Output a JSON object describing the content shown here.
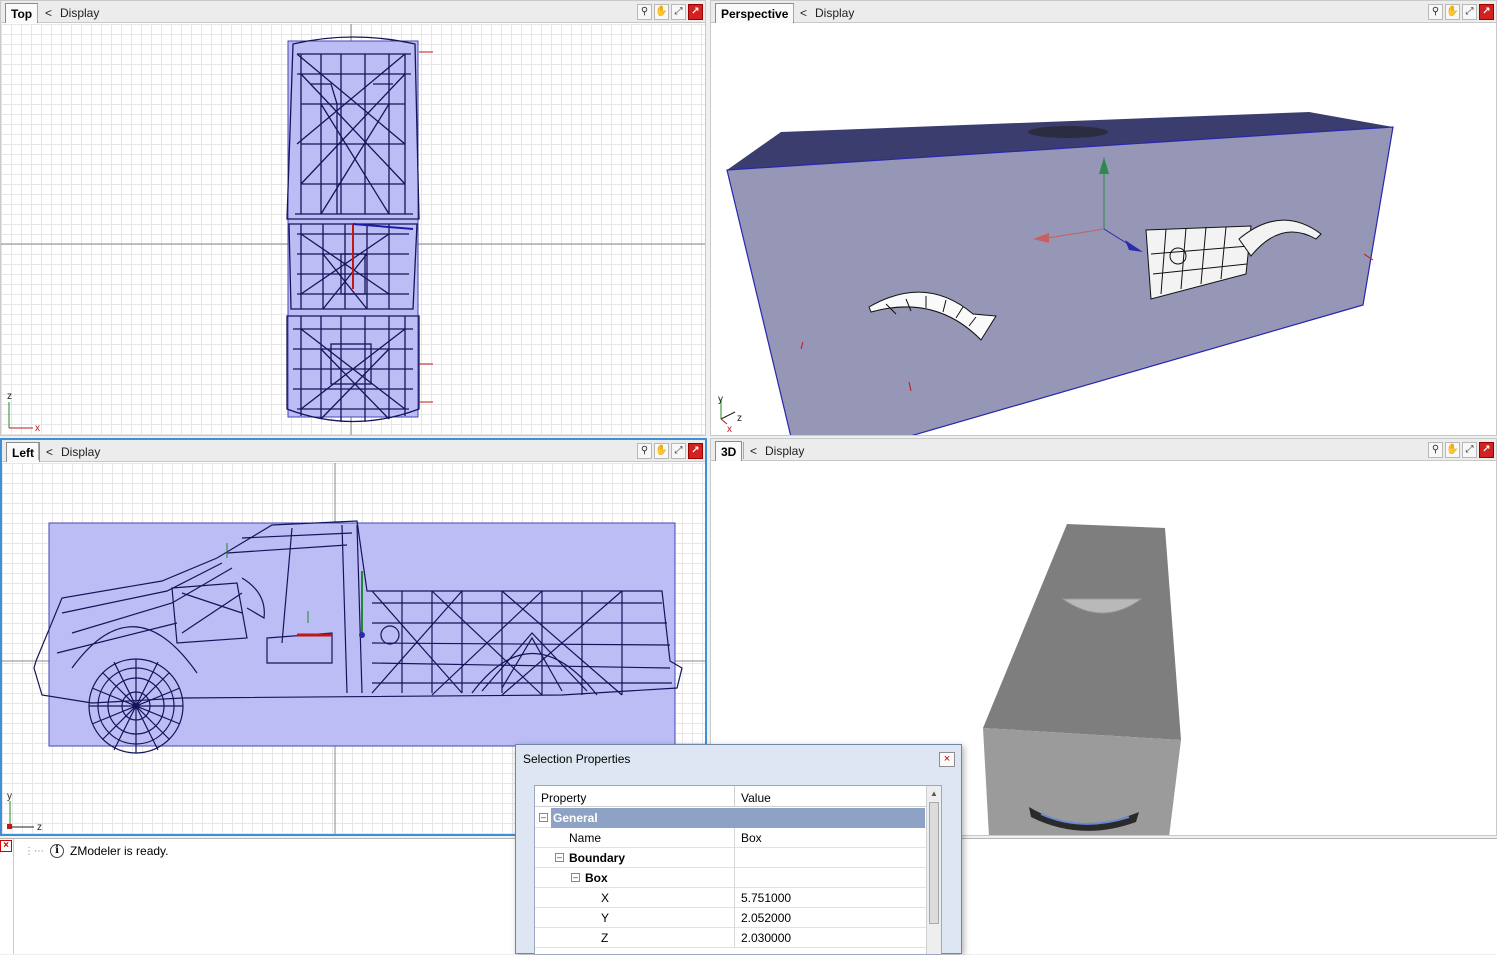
{
  "viewports": {
    "top": {
      "tab": "Top",
      "chevron": "<",
      "display": "Display",
      "axes": {
        "v": "z",
        "h": "x"
      }
    },
    "perspective": {
      "tab": "Perspective",
      "chevron": "<",
      "display": "Display",
      "axes": {
        "v": "y",
        "h": "z",
        "d": "x"
      }
    },
    "left": {
      "tab": "Left",
      "chevron": "<",
      "display": "Display",
      "axes": {
        "v": "y",
        "h": "z"
      }
    },
    "threed": {
      "tab": "3D",
      "chevron": "<",
      "display": "Display"
    }
  },
  "toolbar_icons": [
    "zoom-icon",
    "pan-icon",
    "maximize-icon",
    "close-viewport-icon"
  ],
  "log": {
    "message": "ZModeler is ready.",
    "icon": "info-icon"
  },
  "dialog": {
    "title": "Selection Properties",
    "columns": {
      "property": "Property",
      "value": "Value"
    },
    "rows": [
      {
        "key": "General",
        "value": "",
        "selected": true
      },
      {
        "key": "Name",
        "value": "Box"
      },
      {
        "key": "Boundary",
        "value": ""
      },
      {
        "key": "Box",
        "value": ""
      },
      {
        "key": "X",
        "value": "5.751000"
      },
      {
        "key": "Y",
        "value": "2.052000"
      },
      {
        "key": "Z",
        "value": "2.030000"
      }
    ]
  },
  "colors": {
    "selection_box": "#bdbdf5",
    "wire": "#14145a",
    "accent": "#3d8fd8"
  }
}
